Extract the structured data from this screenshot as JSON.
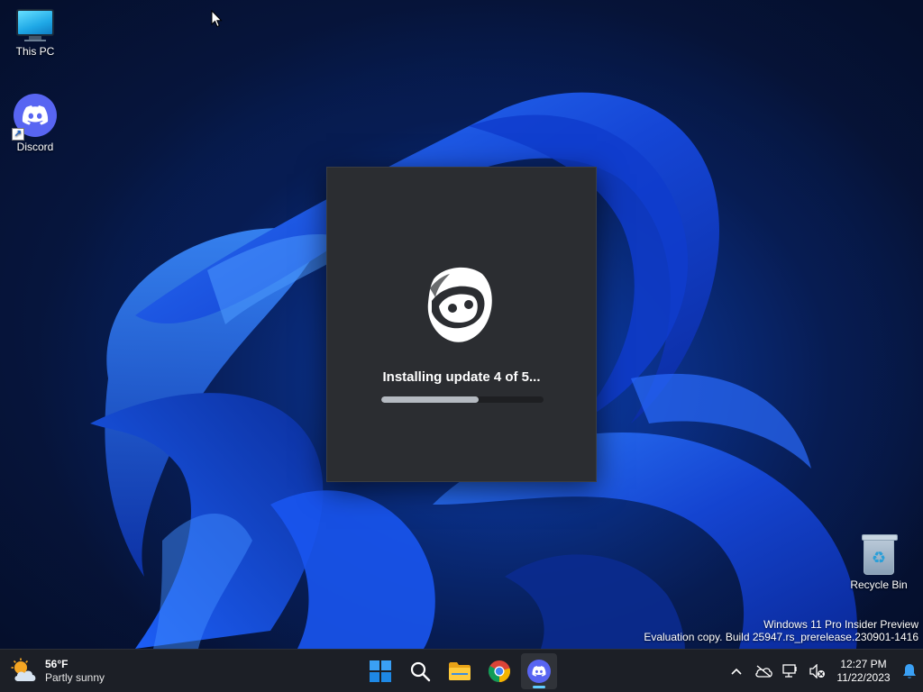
{
  "desktop": {
    "icons": [
      {
        "label": "This PC",
        "icon": "monitor-icon"
      },
      {
        "label": "Discord",
        "icon": "discord-icon"
      },
      {
        "label": "Recycle Bin",
        "icon": "recycle-bin-icon"
      }
    ]
  },
  "updater": {
    "status": "Installing update 4 of 5...",
    "progress": 0.6,
    "logo": "discord-loading-logo"
  },
  "watermark": {
    "line1": "Windows 11 Pro Insider Preview",
    "line2": "Evaluation copy. Build 25947.rs_prerelease.230901-1416"
  },
  "taskbar": {
    "weather": {
      "temp": "56°F",
      "condition": "Partly sunny",
      "icon": "partly-sunny-icon"
    },
    "pinned": [
      {
        "name": "start",
        "icon": "windows-logo-icon"
      },
      {
        "name": "search",
        "icon": "search-icon"
      },
      {
        "name": "file-explorer",
        "icon": "folder-icon"
      },
      {
        "name": "chrome",
        "icon": "chrome-icon"
      },
      {
        "name": "discord",
        "icon": "discord-icon",
        "active": true
      }
    ],
    "tray": {
      "time": "12:27 PM",
      "date": "11/22/2023"
    },
    "colors": {
      "accent": "#60cdff",
      "discord": "#5865f2",
      "taskbar": "#1c1f26"
    }
  }
}
